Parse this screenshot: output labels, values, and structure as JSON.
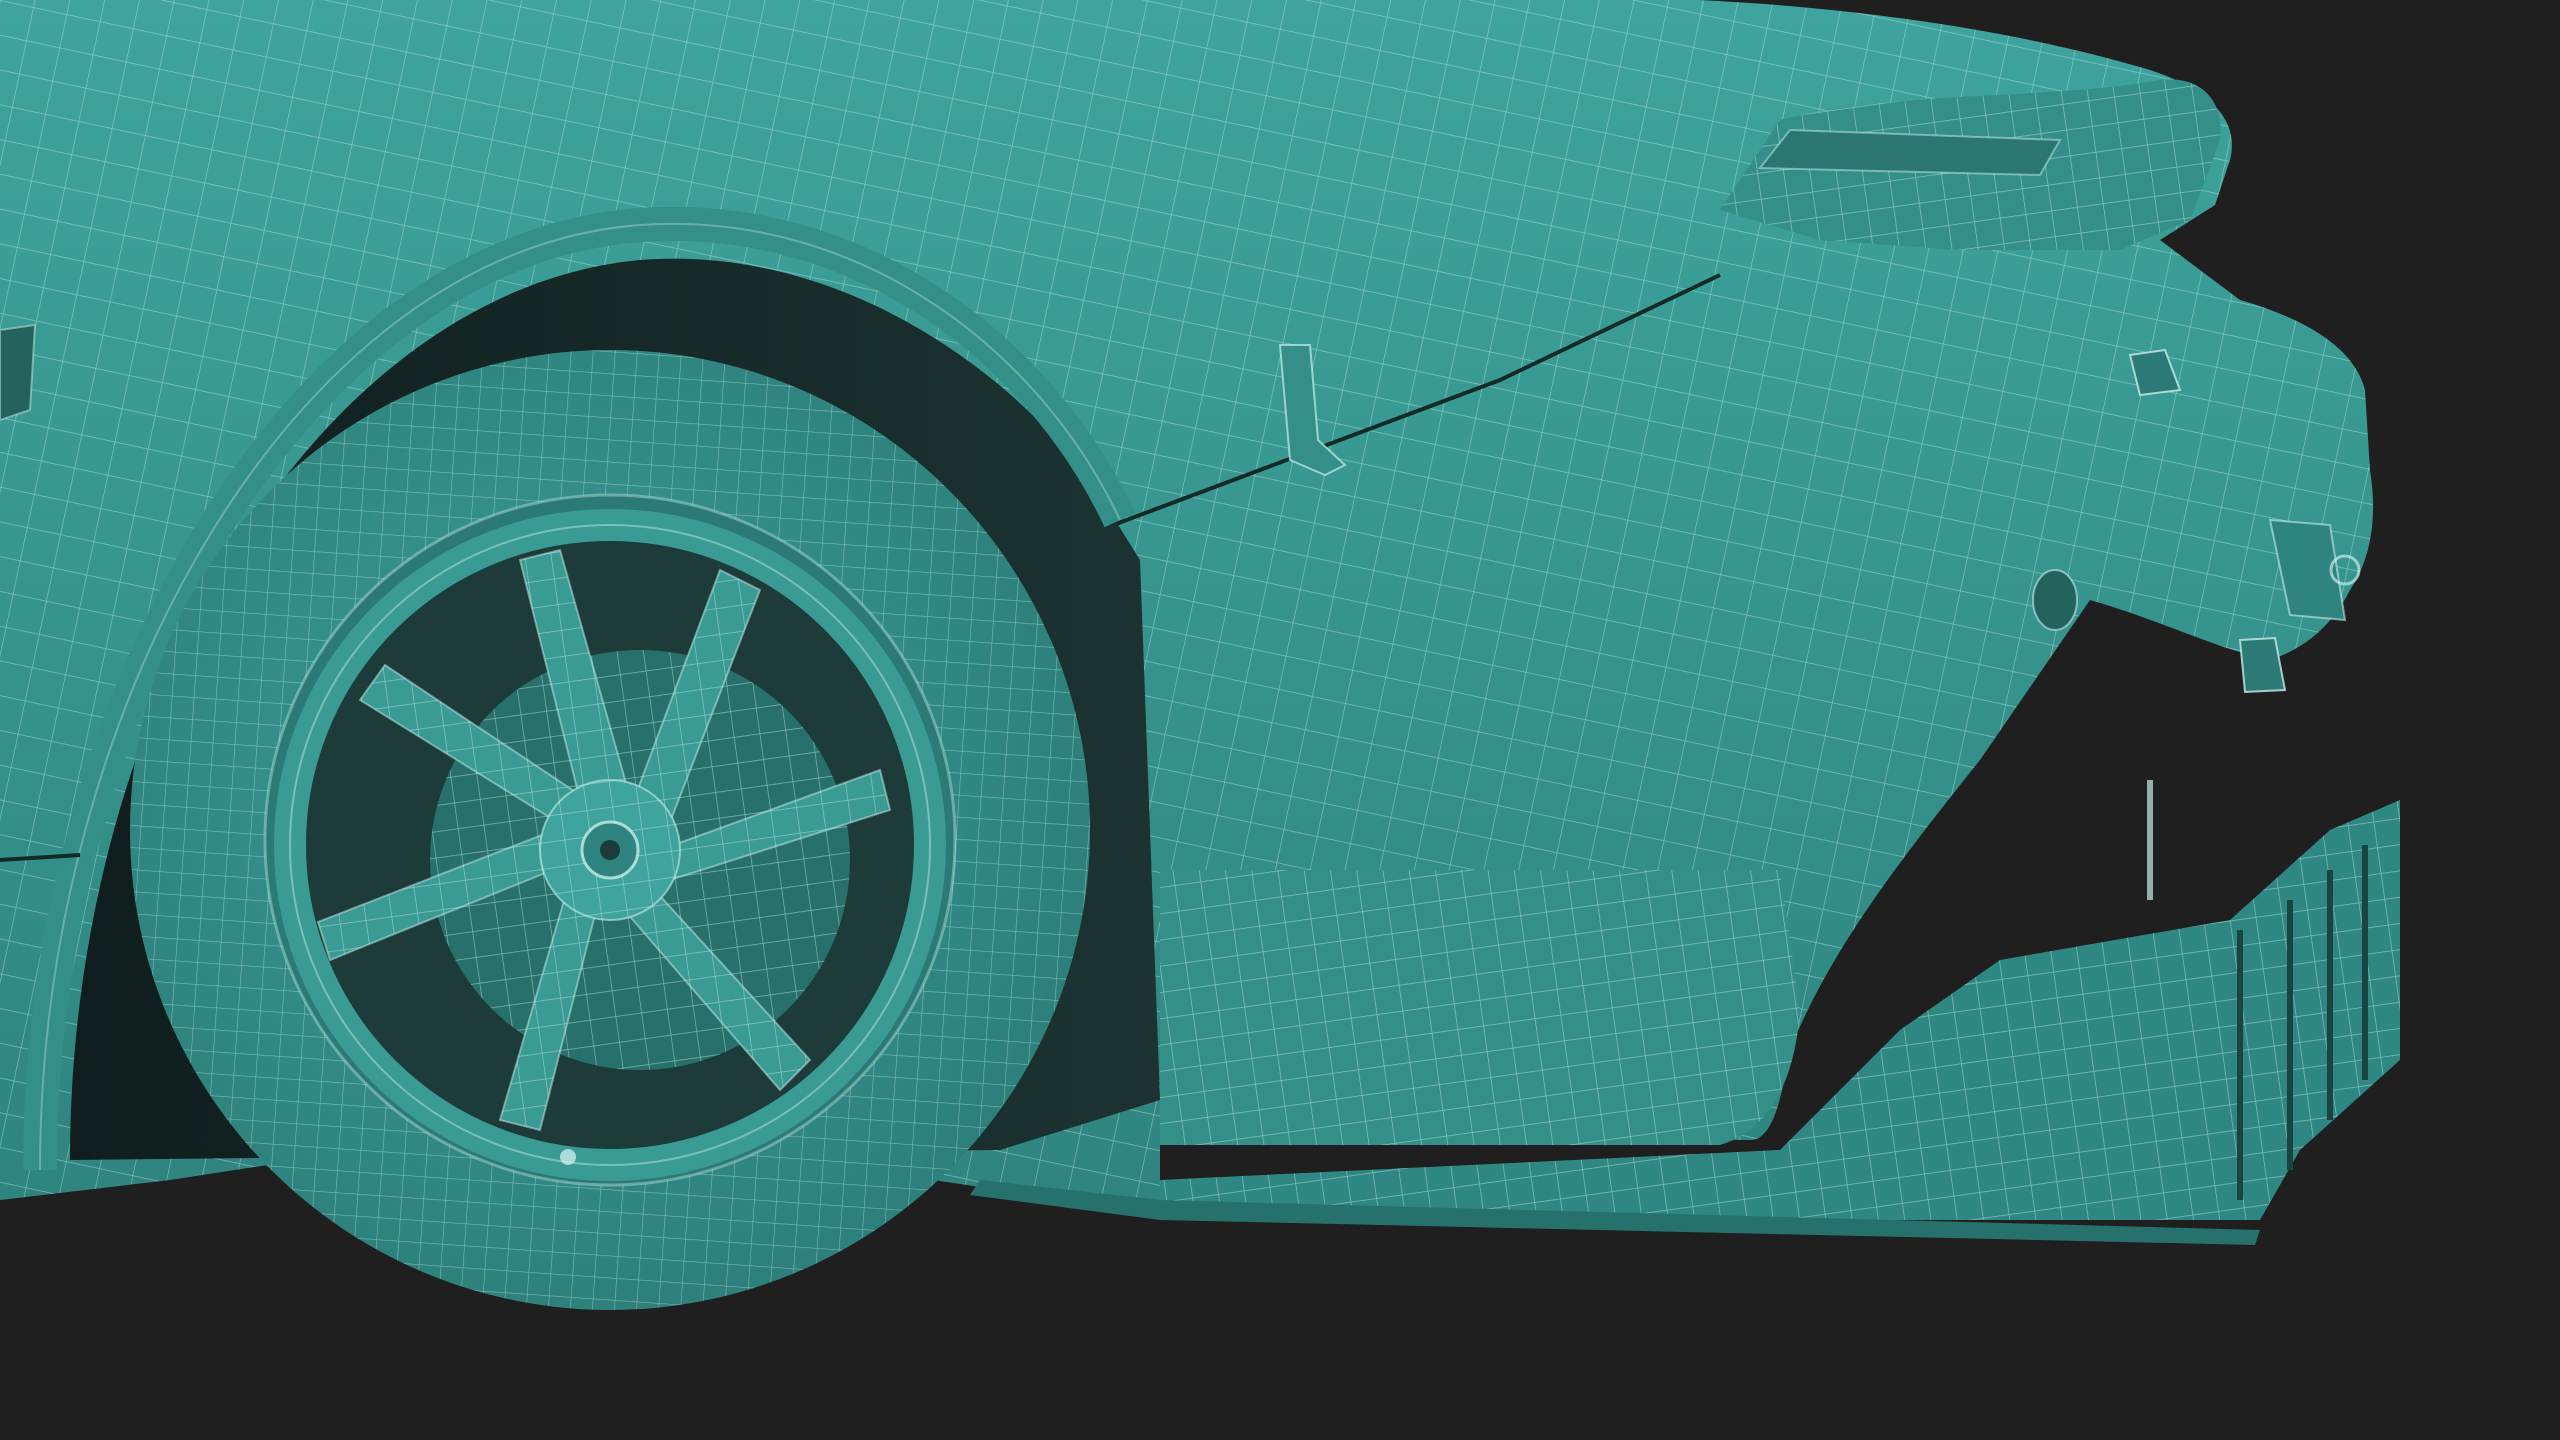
{
  "scene": {
    "subject": "car-rear-quarter-wireframe",
    "background_color": "#1f1f1f",
    "body_color": "#3a9a94",
    "body_shade_color": "#2f827d",
    "body_dark_color": "#25665f",
    "wire_color": "#c8ede9",
    "seam_color": "#122a28"
  }
}
